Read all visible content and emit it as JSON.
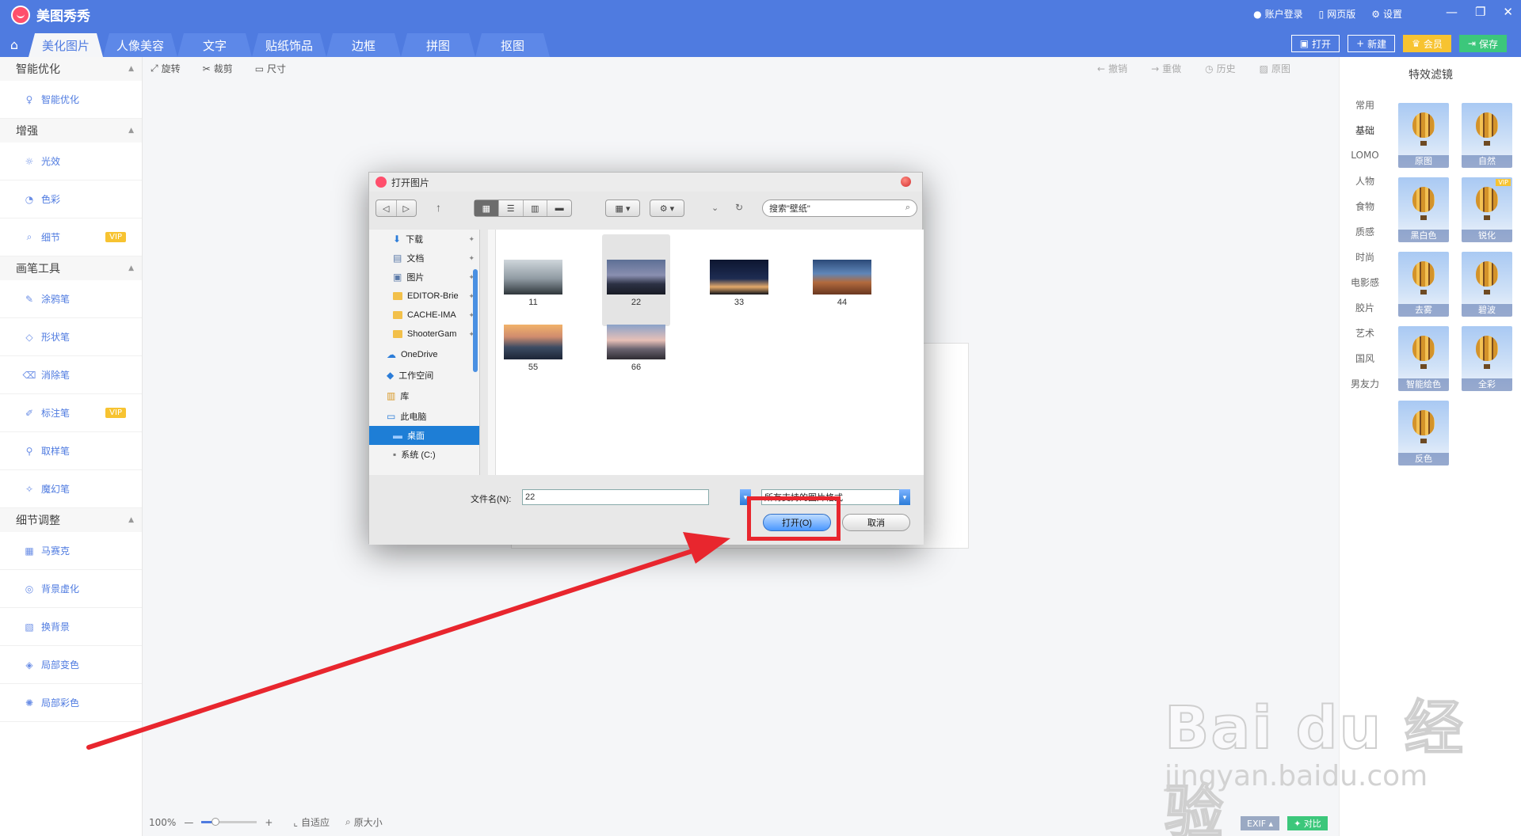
{
  "app": {
    "title": "美图秀秀"
  },
  "topbar": {
    "login": "账户登录",
    "web": "网页版",
    "settings": "设置"
  },
  "tabs": [
    "美化图片",
    "人像美容",
    "文字",
    "贴纸饰品",
    "边框",
    "拼图",
    "抠图"
  ],
  "actions": {
    "open": "打开",
    "new": "新建",
    "member": "会员",
    "save": "保存"
  },
  "sidebar": {
    "sections": [
      {
        "title": "智能优化",
        "items": [
          {
            "label": "智能优化",
            "icon": "bulb-icon"
          }
        ]
      },
      {
        "title": "增强",
        "items": [
          {
            "label": "光效",
            "icon": "sun-icon"
          },
          {
            "label": "色彩",
            "icon": "palette-icon"
          },
          {
            "label": "细节",
            "icon": "magnifier-icon",
            "vip": "VIP"
          }
        ]
      },
      {
        "title": "画笔工具",
        "items": [
          {
            "label": "涂鸦笔",
            "icon": "doodle-icon"
          },
          {
            "label": "形状笔",
            "icon": "shape-icon"
          },
          {
            "label": "消除笔",
            "icon": "eraser-icon"
          },
          {
            "label": "标注笔",
            "icon": "pen-icon",
            "vip": "VIP"
          },
          {
            "label": "取样笔",
            "icon": "dropper-icon"
          },
          {
            "label": "魔幻笔",
            "icon": "magic-icon"
          }
        ]
      },
      {
        "title": "细节调整",
        "items": [
          {
            "label": "马赛克",
            "icon": "mosaic-icon"
          },
          {
            "label": "背景虚化",
            "icon": "blur-icon"
          },
          {
            "label": "换背景",
            "icon": "background-icon"
          },
          {
            "label": "局部变色",
            "icon": "recolor-icon"
          },
          {
            "label": "局部彩色",
            "icon": "color-splash-icon"
          }
        ]
      }
    ]
  },
  "toolbar": {
    "rotate": "旋转",
    "crop": "裁剪",
    "size": "尺寸",
    "undo": "撤销",
    "redo": "重做",
    "history": "历史",
    "original": "原图"
  },
  "right_panel": {
    "title": "特效滤镜",
    "categories": [
      "常用",
      "基础",
      "LOMO",
      "人物",
      "食物",
      "质感",
      "时尚",
      "电影感",
      "胶片",
      "艺术",
      "国风",
      "男友力"
    ],
    "filters": [
      {
        "label": "原图"
      },
      {
        "label": "自然"
      },
      {
        "label": "黑白色"
      },
      {
        "label": "锐化",
        "vip": "VIP"
      },
      {
        "label": "去雾"
      },
      {
        "label": "碧波"
      },
      {
        "label": "智能绘色"
      },
      {
        "label": "全彩"
      },
      {
        "label": "反色"
      }
    ]
  },
  "bottom": {
    "zoom": "100%",
    "fit": "自适应",
    "actual": "原大小",
    "exif": "EXIF",
    "compare": "对比",
    "zoom_level": 0.2
  },
  "dialog": {
    "title": "打开图片",
    "search_placeholder": "搜索\"壁纸\"",
    "nav": [
      {
        "label": "下载",
        "icon": "download-icon",
        "pinned": true
      },
      {
        "label": "文档",
        "icon": "document-icon",
        "pinned": true
      },
      {
        "label": "图片",
        "icon": "pictures-icon",
        "pinned": true
      },
      {
        "label": "EDITOR-Brie",
        "icon": "folder-icon",
        "pinned": true
      },
      {
        "label": "CACHE-IMA",
        "icon": "folder-icon",
        "pinned": true
      },
      {
        "label": "ShooterGam",
        "icon": "folder-icon",
        "pinned": true
      },
      {
        "label": "OneDrive",
        "icon": "cloud-icon",
        "group": true
      },
      {
        "label": "工作空间",
        "icon": "workspace-icon",
        "group": true
      },
      {
        "label": "库",
        "icon": "library-icon",
        "group": true
      },
      {
        "label": "此电脑",
        "icon": "computer-icon",
        "group": true
      },
      {
        "label": "桌面",
        "icon": "desktop-icon",
        "selected": true
      },
      {
        "label": "系统 (C:)",
        "icon": "drive-icon"
      }
    ],
    "files": [
      "11",
      "22",
      "33",
      "44",
      "55",
      "66"
    ],
    "selected_file": "22",
    "filename_label": "文件名(N):",
    "filename_value": "22",
    "format_value": "所有支持的图片格式",
    "open_button": "打开(O)",
    "cancel_button": "取消"
  },
  "watermark": {
    "main": "Bai du 经验",
    "sub": "jingyan.baidu.com"
  },
  "colors": {
    "brand": "#4f7be0",
    "highlight": "#e8262e",
    "vip": "#f7c331",
    "save": "#3cc77b"
  }
}
